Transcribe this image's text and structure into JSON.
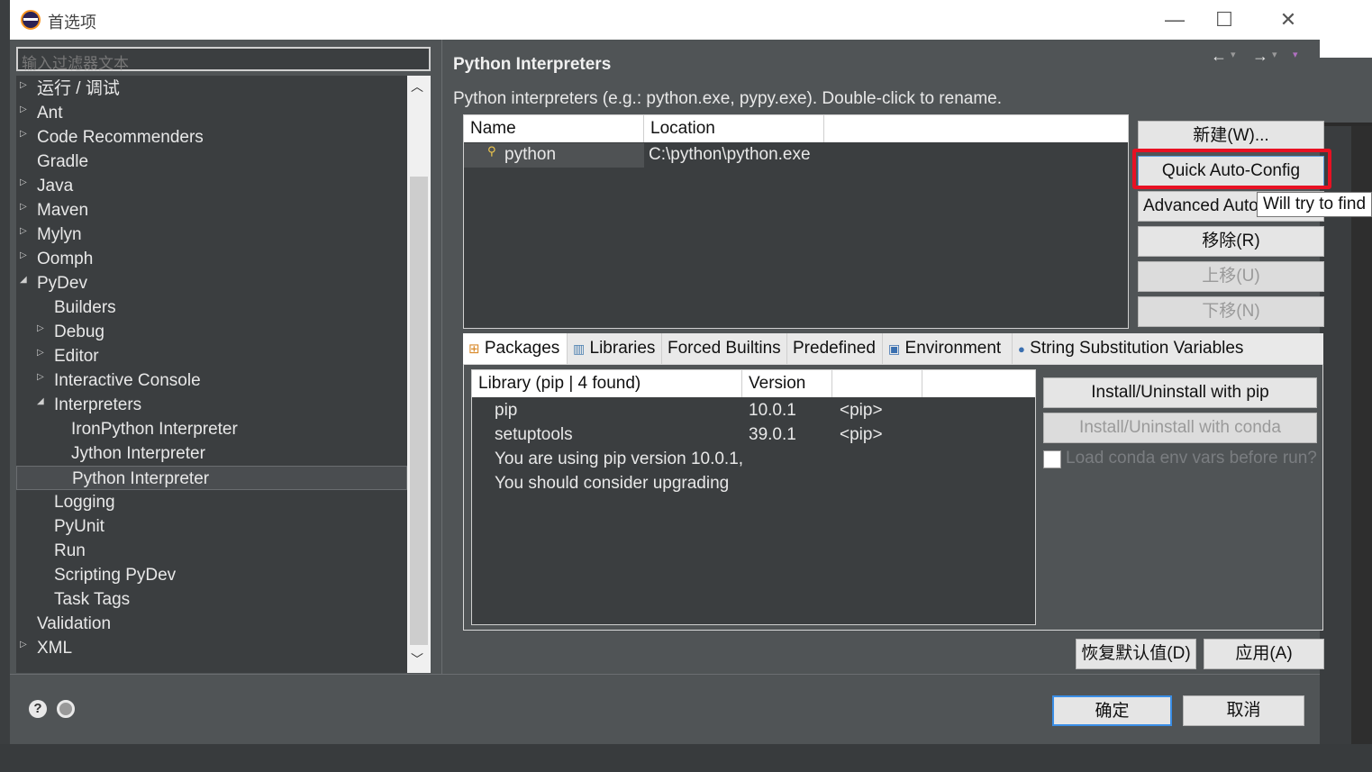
{
  "window": {
    "title": "首选项",
    "minimize": "—",
    "maximize": "☐",
    "close": "✕"
  },
  "filter": {
    "placeholder": "输入过滤器文本"
  },
  "tree": {
    "items": [
      {
        "label": "运行 / 调试",
        "expander": "▷"
      },
      {
        "label": "Ant",
        "expander": "▷"
      },
      {
        "label": "Code Recommenders",
        "expander": "▷"
      },
      {
        "label": "Gradle",
        "expander": ""
      },
      {
        "label": "Java",
        "expander": "▷"
      },
      {
        "label": "Maven",
        "expander": "▷"
      },
      {
        "label": "Mylyn",
        "expander": "▷"
      },
      {
        "label": "Oomph",
        "expander": "▷"
      },
      {
        "label": "PyDev",
        "expander": "◢"
      },
      {
        "label": "Builders",
        "expander": ""
      },
      {
        "label": "Debug",
        "expander": "▷"
      },
      {
        "label": "Editor",
        "expander": "▷"
      },
      {
        "label": "Interactive Console",
        "expander": "▷"
      },
      {
        "label": "Interpreters",
        "expander": "◢"
      },
      {
        "label": "IronPython Interpreter",
        "expander": ""
      },
      {
        "label": "Jython Interpreter",
        "expander": ""
      },
      {
        "label": "Python Interpreter",
        "expander": ""
      },
      {
        "label": "Logging",
        "expander": ""
      },
      {
        "label": "PyUnit",
        "expander": ""
      },
      {
        "label": "Run",
        "expander": ""
      },
      {
        "label": "Scripting PyDev",
        "expander": ""
      },
      {
        "label": "Task Tags",
        "expander": ""
      },
      {
        "label": "Validation",
        "expander": ""
      },
      {
        "label": "XML",
        "expander": "▷"
      }
    ]
  },
  "page": {
    "title": "Python Interpreters",
    "description": "Python interpreters (e.g.: python.exe, pypy.exe).   Double-click to rename.",
    "nav": {
      "back": "←",
      "forward": "→",
      "menu": "▾"
    }
  },
  "interpreters_table": {
    "columns": [
      "Name",
      "Location"
    ],
    "rows": [
      {
        "name": "python",
        "location": "C:\\python\\python.exe"
      }
    ]
  },
  "side_buttons": {
    "new": "新建(W)...",
    "quick": "Quick Auto-Config",
    "advanced": "Advanced Auto-",
    "remove": "移除(R)",
    "up": "上移(U)",
    "down": "下移(N)"
  },
  "tooltip": "Will try to find",
  "tabs": [
    {
      "label": "Packages",
      "icon": "packages-icon"
    },
    {
      "label": "Libraries",
      "icon": "libraries-icon"
    },
    {
      "label": "Forced Builtins",
      "icon": ""
    },
    {
      "label": "Predefined",
      "icon": ""
    },
    {
      "label": "Environment",
      "icon": "environment-icon"
    },
    {
      "label": "String Substitution Variables",
      "icon": "variable-icon"
    }
  ],
  "packages_table": {
    "columns": [
      "Library (pip | 4 found)",
      "Version"
    ],
    "rows": [
      {
        "library": "pip",
        "version": "10.0.1",
        "source": "<pip>"
      },
      {
        "library": "setuptools",
        "version": "39.0.1",
        "source": "<pip>"
      },
      {
        "library": "You are using pip version 10.0.1,",
        "version": "",
        "source": ""
      },
      {
        "library": "You should consider upgrading",
        "version": "",
        "source": ""
      }
    ]
  },
  "package_buttons": {
    "pip": "Install/Uninstall with pip",
    "conda": "Install/Uninstall with conda",
    "conda_checkbox": "Load conda env vars before run?"
  },
  "page_buttons": {
    "restore": "恢复默认值(D)",
    "apply": "应用(A)"
  },
  "footer": {
    "help_icon": "?",
    "ok": "确定",
    "cancel": "取消"
  },
  "colors": {
    "highlight": "#e81123",
    "panel": "#505456",
    "list_bg": "#3b3e40"
  }
}
